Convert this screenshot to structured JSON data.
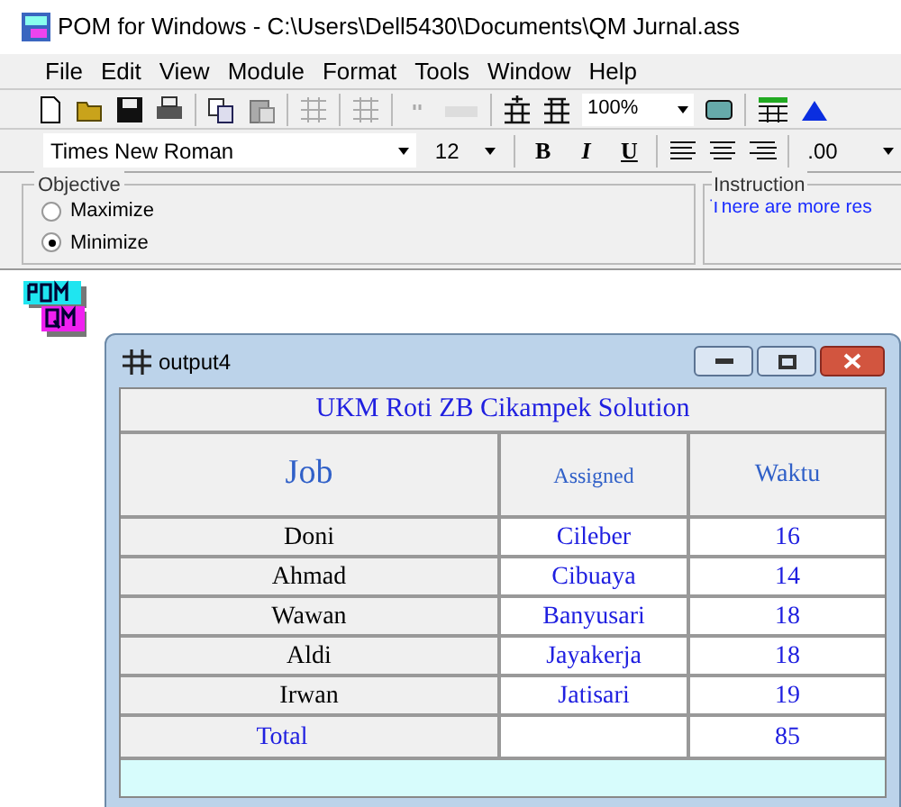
{
  "window": {
    "title": "POM for Windows - C:\\Users\\Dell5430\\Documents\\QM Jurnal.ass"
  },
  "menu": [
    "File",
    "Edit",
    "View",
    "Module",
    "Format",
    "Tools",
    "Window",
    "Help"
  ],
  "toolbar": {
    "zoom": "100%"
  },
  "format_bar": {
    "font": "Times New Roman",
    "size": "12",
    "bold": "B",
    "italic": "I",
    "underline": "U",
    "decimals": ".00"
  },
  "objective": {
    "label": "Objective",
    "options": [
      {
        "label": "Maximize",
        "selected": false
      },
      {
        "label": "Minimize",
        "selected": true
      }
    ]
  },
  "instruction": {
    "label": "Instruction",
    "text": "There are more res"
  },
  "output_window": {
    "title": "output4",
    "table_title": "UKM Roti ZB Cikampek Solution",
    "columns": [
      "Job",
      "Assigned",
      "Waktu"
    ],
    "rows": [
      {
        "job": "Doni",
        "assigned": "Cileber",
        "waktu": "16"
      },
      {
        "job": "Ahmad",
        "assigned": "Cibuaya",
        "waktu": "14"
      },
      {
        "job": "Wawan",
        "assigned": "Banyusari",
        "waktu": "18"
      },
      {
        "job": "Aldi",
        "assigned": "Jayakerja",
        "waktu": "18"
      },
      {
        "job": "Irwan",
        "assigned": "Jatisari",
        "waktu": "19"
      }
    ],
    "total": {
      "label": "Total",
      "waktu": "85"
    }
  }
}
